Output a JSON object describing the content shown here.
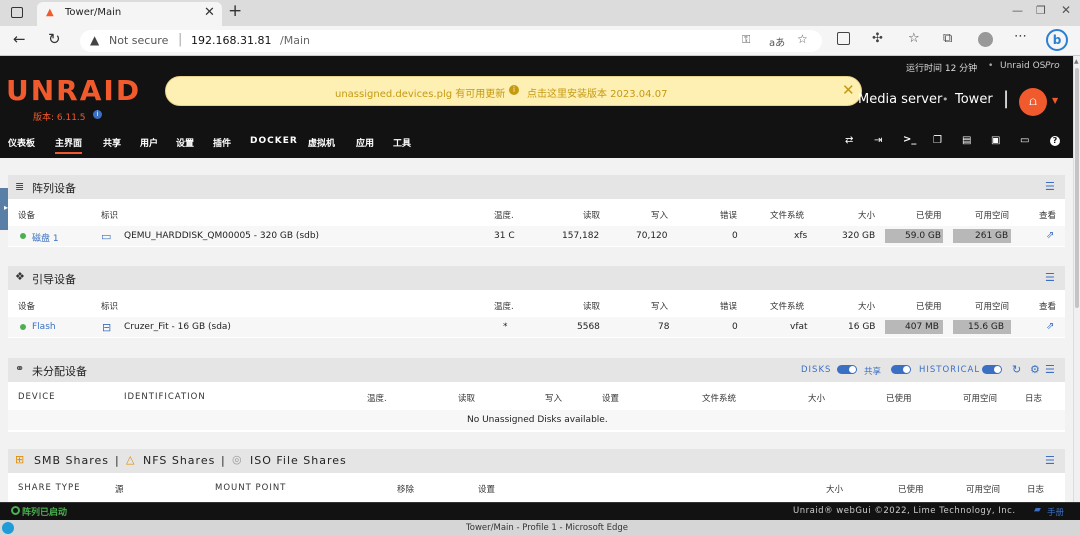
{
  "browser": {
    "tab_title": "Tower/Main",
    "security": "Not secure",
    "url_host": "192.168.31.81",
    "url_path": "/Main"
  },
  "header": {
    "logo": "UNRAID",
    "version": "版本: 6.11.5",
    "uptime": "运行时间 12 分钟",
    "os_label": "Unraid OS",
    "os_edition": "Pro",
    "server_desc": "Media server",
    "server_name": "Tower",
    "banner_text": "unassigned.devices.plg 有可用更新",
    "banner_link": "点击这里安装版本 2023.04.07"
  },
  "nav": [
    "仪表板",
    "主界面",
    "共享",
    "用户",
    "设置",
    "插件",
    "DOCKER",
    "虚拟机",
    "应用",
    "工具"
  ],
  "array": {
    "title": "阵列设备",
    "headers": [
      "设备",
      "标识",
      "温度.",
      "读取",
      "写入",
      "错误",
      "文件系统",
      "大小",
      "已使用",
      "可用空间",
      "查看"
    ],
    "rows": [
      {
        "device": "磁盘 1",
        "id": "QEMU_HARDDISK_QM00005 - 320 GB (sdb)",
        "temp": "31 C",
        "reads": "157,182",
        "writes": "70,120",
        "errors": "0",
        "fs": "xfs",
        "size": "320 GB",
        "used": "59.0 GB",
        "free": "261 GB",
        "used_frac": 0.18,
        "free_frac": 0.82
      }
    ]
  },
  "boot": {
    "title": "引导设备",
    "headers": [
      "设备",
      "标识",
      "温度.",
      "读取",
      "写入",
      "错误",
      "文件系统",
      "大小",
      "已使用",
      "可用空间",
      "查看"
    ],
    "rows": [
      {
        "device": "Flash",
        "id": "Cruzer_Fit - 16 GB (sda)",
        "temp": "*",
        "reads": "5568",
        "writes": "78",
        "errors": "0",
        "fs": "vfat",
        "size": "16 GB",
        "used": "407 MB",
        "free": "15.6 GB",
        "used_frac": 0.03,
        "free_frac": 0.97
      }
    ]
  },
  "unassigned": {
    "title": "未分配设备",
    "toggle_disks": "DISKS",
    "toggle_shares": "共享",
    "toggle_historical": "HISTORICAL",
    "headers": [
      "DEVICE",
      "IDENTIFICATION",
      "温度.",
      "读取",
      "写入",
      "设置",
      "文件系统",
      "大小",
      "已使用",
      "可用空间",
      "日志"
    ],
    "empty": "No Unassigned Disks available."
  },
  "shares": {
    "smb": "SMB Shares",
    "nfs": "NFS Shares",
    "iso": "ISO File Shares",
    "sep": "|",
    "headers": [
      "SHARE TYPE",
      "源",
      "MOUNT POINT",
      "移除",
      "设置",
      "大小",
      "已使用",
      "可用空间",
      "日志"
    ]
  },
  "footer": {
    "status": "阵列已启动",
    "copyright": "Unraid® webGui ©2022, Lime Technology, Inc.",
    "manual": "手册"
  },
  "taskbar": {
    "title": "Tower/Main - Profile 1 - Microsoft Edge"
  },
  "colors": {
    "brand_orange": "#f15a2c",
    "banner_bg": "#feefb3",
    "link_blue": "#3a6fc4",
    "status_green": "#4caf50"
  }
}
